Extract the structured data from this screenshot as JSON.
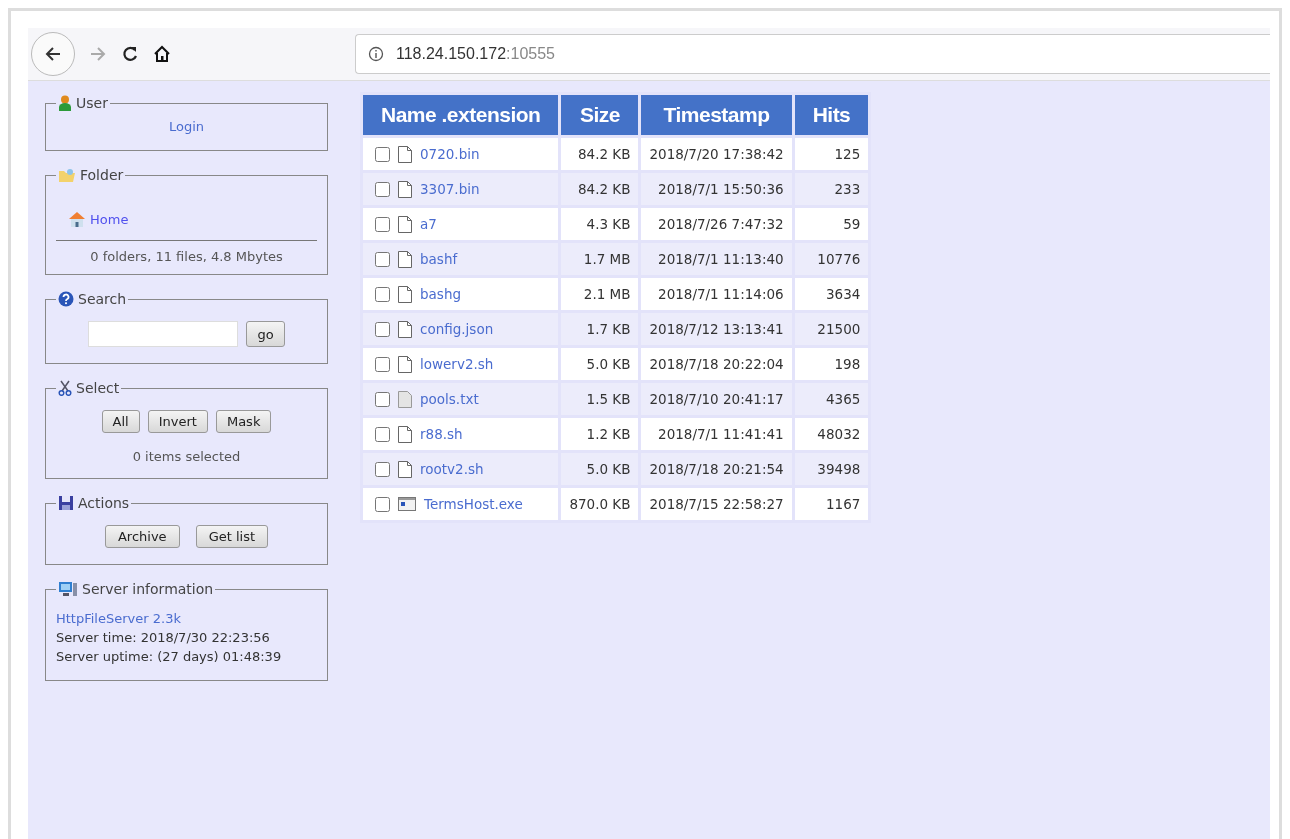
{
  "browser": {
    "address_host": "118.24.150.172",
    "address_port": ":10555"
  },
  "sidebar": {
    "user": {
      "title": "User",
      "login": "Login"
    },
    "folder": {
      "title": "Folder",
      "home": "Home",
      "summary": "0 folders, 11 files, 4.8 Mbytes"
    },
    "search": {
      "title": "Search",
      "button": "go"
    },
    "select": {
      "title": "Select",
      "buttons": [
        "All",
        "Invert",
        "Mask"
      ],
      "status": "0 items selected"
    },
    "actions": {
      "title": "Actions",
      "buttons": [
        "Archive",
        "Get list"
      ]
    },
    "server": {
      "title": "Server information",
      "link": "HttpFileServer 2.3k",
      "lines": [
        "Server time: 2018/7/30 22:23:56",
        "Server uptime: (27 days) 01:48:39"
      ]
    }
  },
  "table": {
    "columns": [
      "Name .extension",
      "Size",
      "Timestamp",
      "Hits"
    ],
    "rows": [
      {
        "kind": "file",
        "checked": false,
        "name": "0720.bin",
        "size": "84.2 KB",
        "timestamp": "2018/7/20 17:38:42",
        "hits": "125"
      },
      {
        "kind": "file",
        "checked": false,
        "name": "3307.bin",
        "size": "84.2 KB",
        "timestamp": "2018/7/1 15:50:36",
        "hits": "233"
      },
      {
        "kind": "file",
        "checked": false,
        "name": "a7",
        "size": "4.3 KB",
        "timestamp": "2018/7/26 7:47:32",
        "hits": "59"
      },
      {
        "kind": "file",
        "checked": false,
        "name": "bashf",
        "size": "1.7 MB",
        "timestamp": "2018/7/1 11:13:40",
        "hits": "10776"
      },
      {
        "kind": "file",
        "checked": false,
        "name": "bashg",
        "size": "2.1 MB",
        "timestamp": "2018/7/1 11:14:06",
        "hits": "3634"
      },
      {
        "kind": "file",
        "checked": false,
        "name": "config.json",
        "size": "1.7 KB",
        "timestamp": "2018/7/12 13:13:41",
        "hits": "21500"
      },
      {
        "kind": "file",
        "checked": false,
        "name": "lowerv2.sh",
        "size": "5.0 KB",
        "timestamp": "2018/7/18 20:22:04",
        "hits": "198"
      },
      {
        "kind": "text",
        "checked": false,
        "name": "pools.txt",
        "size": "1.5 KB",
        "timestamp": "2018/7/10 20:41:17",
        "hits": "4365"
      },
      {
        "kind": "file",
        "checked": false,
        "name": "r88.sh",
        "size": "1.2 KB",
        "timestamp": "2018/7/1 11:41:41",
        "hits": "48032"
      },
      {
        "kind": "file",
        "checked": false,
        "name": "rootv2.sh",
        "size": "5.0 KB",
        "timestamp": "2018/7/18 20:21:54",
        "hits": "39498"
      },
      {
        "kind": "exe",
        "checked": false,
        "name": "TermsHost.exe",
        "size": "870.0 KB",
        "timestamp": "2018/7/15 22:58:27",
        "hits": "1167"
      }
    ]
  }
}
